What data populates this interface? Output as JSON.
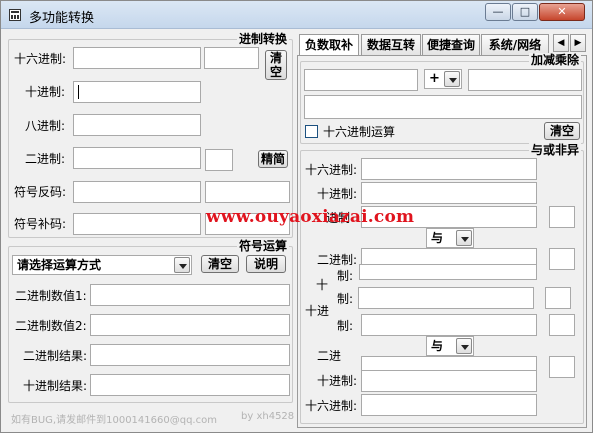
{
  "window": {
    "title": "多功能转换",
    "min_label": "—",
    "max_label": "□",
    "close_label": "✕"
  },
  "base_convert": {
    "title": "进制转换",
    "hex_label": "十六进制:",
    "dec_label": "十进制:",
    "oct_label": "八进制:",
    "bin_label": "二进制:",
    "ones_label": "符号反码:",
    "twos_label": "符号补码:",
    "clear_label": "清空",
    "simplify_label": "精简"
  },
  "symbol_ops": {
    "title": "符号运算",
    "select_value": "请选择运算方式",
    "clear_label": "清空",
    "help_label": "说明",
    "bin_value1_label": "二进制数值1:",
    "bin_value2_label": "二进制数值2:",
    "bin_result_label": "二进制结果:",
    "dec_result_label": "十进制结果:"
  },
  "tabs": {
    "items": [
      "负数取补",
      "数据互转",
      "便捷查询",
      "系统/网络"
    ],
    "left_arrow": "◀",
    "right_arrow": "▶"
  },
  "arith": {
    "title": "加减乘除",
    "operator": "+",
    "hex_check_label": "十六进制运算",
    "clear_label": "清空"
  },
  "logic": {
    "title": "与或非异",
    "hex_label": "十六进制:",
    "dec_label": "十进制:",
    "bin_label": "二进制:",
    "op1": "与",
    "op2": "与",
    "partial_bin_label": "进制",
    "partial_hex_label": "十进",
    "partial_dec_label": "十",
    "ghost_label_a": "制:",
    "ghost_label_b": "十进",
    "ghost_label_c": "制:",
    "ghost_label_d": "二进"
  },
  "watermark": "www.ouyaoxiazai.com",
  "footer": {
    "bug_note": "如有BUG,请发邮件到1000141660@qq.com",
    "author": "by xh4528"
  }
}
